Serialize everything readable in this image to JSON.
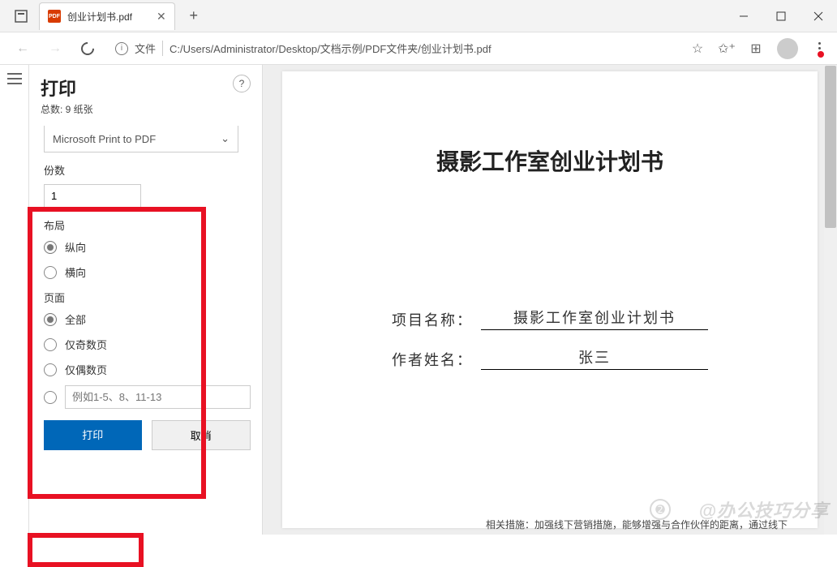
{
  "tab": {
    "title": "创业计划书.pdf"
  },
  "addr": {
    "file_label": "文件",
    "url": "C:/Users/Administrator/Desktop/文档示例/PDF文件夹/创业计划书.pdf"
  },
  "print": {
    "title": "打印",
    "sub": "总数: 9 纸张",
    "printer_select": "Microsoft Print to PDF",
    "copies_label": "份数",
    "copies_value": "1",
    "layout_label": "布局",
    "layout_portrait": "纵向",
    "layout_landscape": "横向",
    "pages_label": "页面",
    "pages_all": "全部",
    "pages_odd": "仅奇数页",
    "pages_even": "仅偶数页",
    "range_placeholder": "例如1-5、8、11-13",
    "btn_print": "打印",
    "btn_cancel": "取消"
  },
  "doc": {
    "title": "摄影工作室创业计划书",
    "field1_lbl": "项目名称：",
    "field1_val": "摄影工作室创业计划书",
    "field2_lbl": "作者姓名：",
    "field2_val": "张三"
  },
  "watermark": "@办公技巧分享",
  "mask": "相关措施：加强线下营销措施，能够增强与合作伙伴的距离，通过线下"
}
